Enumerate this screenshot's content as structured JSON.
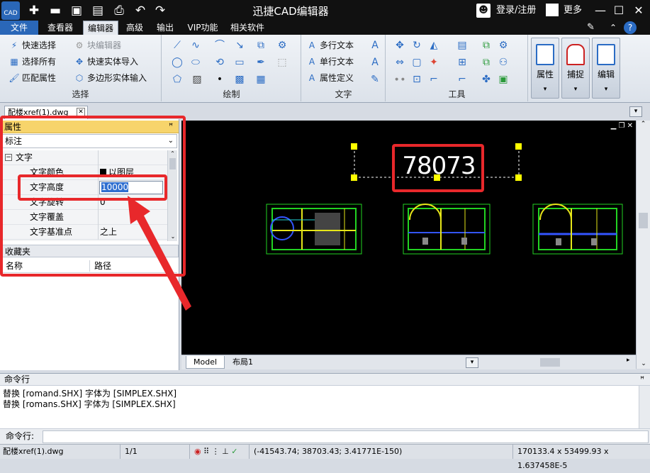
{
  "app": {
    "title": "迅捷CAD编辑器",
    "logo_text": "CAD",
    "login": "登录/注册",
    "more": "更多"
  },
  "menu": {
    "tabs": [
      "文件",
      "查看器",
      "编辑器",
      "高级",
      "输出",
      "VIP功能",
      "相关软件"
    ],
    "active": "编辑器"
  },
  "ribbon": {
    "select": {
      "label": "选择",
      "items": [
        "快速选择",
        "选择所有",
        "匹配属性",
        "块编辑器",
        "快速实体导入",
        "多边形实体输入"
      ]
    },
    "draw": {
      "label": "绘制"
    },
    "text": {
      "label": "文字",
      "items": [
        "多行文本",
        "单行文本",
        "属性定义"
      ]
    },
    "tools": {
      "label": "工具"
    },
    "big": [
      "属性",
      "捕捉",
      "编辑"
    ]
  },
  "doc_tab": "配楼xref(1).dwg",
  "properties": {
    "title": "属性",
    "selected_type": "标注",
    "section": "文字",
    "rows": [
      {
        "key": "文字颜色",
        "value": "以图层"
      },
      {
        "key": "文字高度",
        "value": "10000"
      },
      {
        "key": "文字旋转",
        "value": "0"
      },
      {
        "key": "文字覆盖",
        "value": ""
      },
      {
        "key": "文字基准点",
        "value": "之上"
      }
    ]
  },
  "favorites": {
    "title": "收藏夹",
    "col_name": "名称",
    "col_path": "路径"
  },
  "canvas": {
    "dimension_text": "78073"
  },
  "layout_tabs": [
    "Model",
    "布局1"
  ],
  "command": {
    "title": "命令行",
    "lines": [
      "替换 [romand.SHX] 字体为 [SIMPLEX.SHX]",
      "替换 [romans.SHX] 字体为 [SIMPLEX.SHX]"
    ],
    "prompt": "命令行:"
  },
  "status": {
    "file": "配楼xref(1).dwg",
    "page": "1/1",
    "coords": "(-41543.74; 38703.43; 3.41771E-150)",
    "size": "170133.4 x 53499.93 x 1.637458E-5"
  },
  "colors": {
    "highlight": "#e8282b",
    "accent": "#2b6cc4",
    "file_tab": "#2a67b8"
  }
}
